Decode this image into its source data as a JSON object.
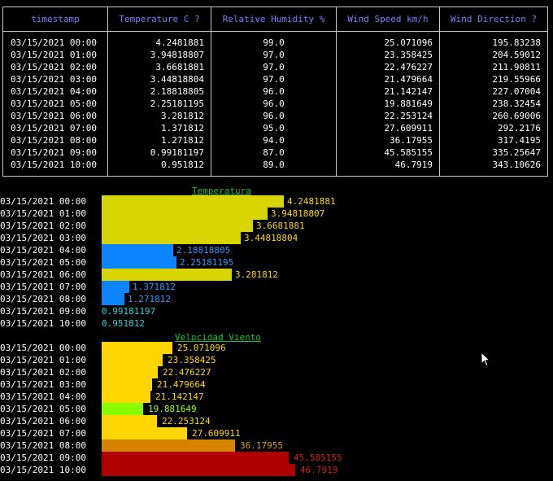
{
  "table": {
    "headers": [
      "timestamp",
      "Temperature C ?",
      "Relative Humidity %",
      "Wind Speed km/h",
      "Wind Direction ?"
    ],
    "rows": [
      [
        "03/15/2021 00:00",
        "4.2481881",
        "99.0",
        "25.071096",
        "195.83238"
      ],
      [
        "03/15/2021 01:00",
        "3.94818807",
        "97.0",
        "23.358425",
        "204.59012"
      ],
      [
        "03/15/2021 02:00",
        "3.6681881",
        "97.0",
        "22.476227",
        "211.90811"
      ],
      [
        "03/15/2021 03:00",
        "3.44818804",
        "97.0",
        "21.479664",
        "219.55966"
      ],
      [
        "03/15/2021 04:00",
        "2.18818805",
        "96.0",
        "21.142147",
        "227.07004"
      ],
      [
        "03/15/2021 05:00",
        "2.25181195",
        "96.0",
        "19.881649",
        "238.32454"
      ],
      [
        "03/15/2021 06:00",
        "3.281812",
        "96.0",
        "22.253124",
        "260.69006"
      ],
      [
        "03/15/2021 07:00",
        "1.371812",
        "95.0",
        "27.609911",
        "292.2176"
      ],
      [
        "03/15/2021 08:00",
        "1.271812",
        "94.0",
        "36.17955",
        "317.4195"
      ],
      [
        "03/15/2021 09:00",
        "0.99181197",
        "87.0",
        "45.585155",
        "335.25647"
      ],
      [
        "03/15/2021 10:00",
        "0.951812",
        "89.0",
        "46.7919",
        "343.10626"
      ]
    ]
  },
  "chart_data": [
    {
      "type": "bar",
      "orientation": "horizontal",
      "title": "Temperatura",
      "categories": [
        "03/15/2021 00:00",
        "03/15/2021 01:00",
        "03/15/2021 02:00",
        "03/15/2021 03:00",
        "03/15/2021 04:00",
        "03/15/2021 05:00",
        "03/15/2021 06:00",
        "03/15/2021 07:00",
        "03/15/2021 08:00",
        "03/15/2021 09:00",
        "03/15/2021 10:00"
      ],
      "values": [
        4.2481881,
        3.94818807,
        3.6681881,
        3.44818804,
        2.18818805,
        2.25181195,
        3.281812,
        1.371812,
        1.271812,
        0.99181197,
        0.951812
      ],
      "labels": [
        "4.2481881",
        "3.94818807",
        "3.6681881",
        "3.44818804",
        "2.18818805",
        "2.25181195",
        "3.281812",
        "1.371812",
        "1.271812",
        "0.99181197",
        "0.951812"
      ],
      "colors": [
        "#d8d400",
        "#d8d400",
        "#d8d400",
        "#d8d400",
        "#0a84ff",
        "#0a84ff",
        "#d8d400",
        "#0a84ff",
        "#0a84ff",
        "#20d8d8",
        "#20d8d8"
      ],
      "label_colors": [
        "#ffd700",
        "#ffd700",
        "#ffd700",
        "#ffd700",
        "#2e9bff",
        "#2e9bff",
        "#ffd700",
        "#2e9bff",
        "#2e9bff",
        "#20d8d8",
        "#20d8d8"
      ]
    },
    {
      "type": "bar",
      "orientation": "horizontal",
      "title": "Velocidad Viento",
      "categories": [
        "03/15/2021 00:00",
        "03/15/2021 01:00",
        "03/15/2021 02:00",
        "03/15/2021 03:00",
        "03/15/2021 04:00",
        "03/15/2021 05:00",
        "03/15/2021 06:00",
        "03/15/2021 07:00",
        "03/15/2021 08:00",
        "03/15/2021 09:00",
        "03/15/2021 10:00"
      ],
      "values": [
        25.071096,
        23.358425,
        22.476227,
        21.479664,
        21.142147,
        19.881649,
        22.253124,
        27.609911,
        36.17955,
        45.585155,
        46.7919
      ],
      "labels": [
        "25.071096",
        "23.358425",
        "22.476227",
        "21.479664",
        "21.142147",
        "19.881649",
        "22.253124",
        "27.609911",
        "36.17955",
        "45.585155",
        "46.7919"
      ],
      "colors": [
        "#ffd500",
        "#ffd500",
        "#ffd500",
        "#ffd500",
        "#ffd500",
        "#88ff00",
        "#ffd500",
        "#ffd500",
        "#d68400",
        "#b00000",
        "#b00000"
      ],
      "label_colors": [
        "#ffd700",
        "#ffd700",
        "#ffd700",
        "#ffd700",
        "#ffd700",
        "#a0ff20",
        "#ffd700",
        "#ffd700",
        "#e09a20",
        "#d02020",
        "#d02020"
      ]
    }
  ]
}
